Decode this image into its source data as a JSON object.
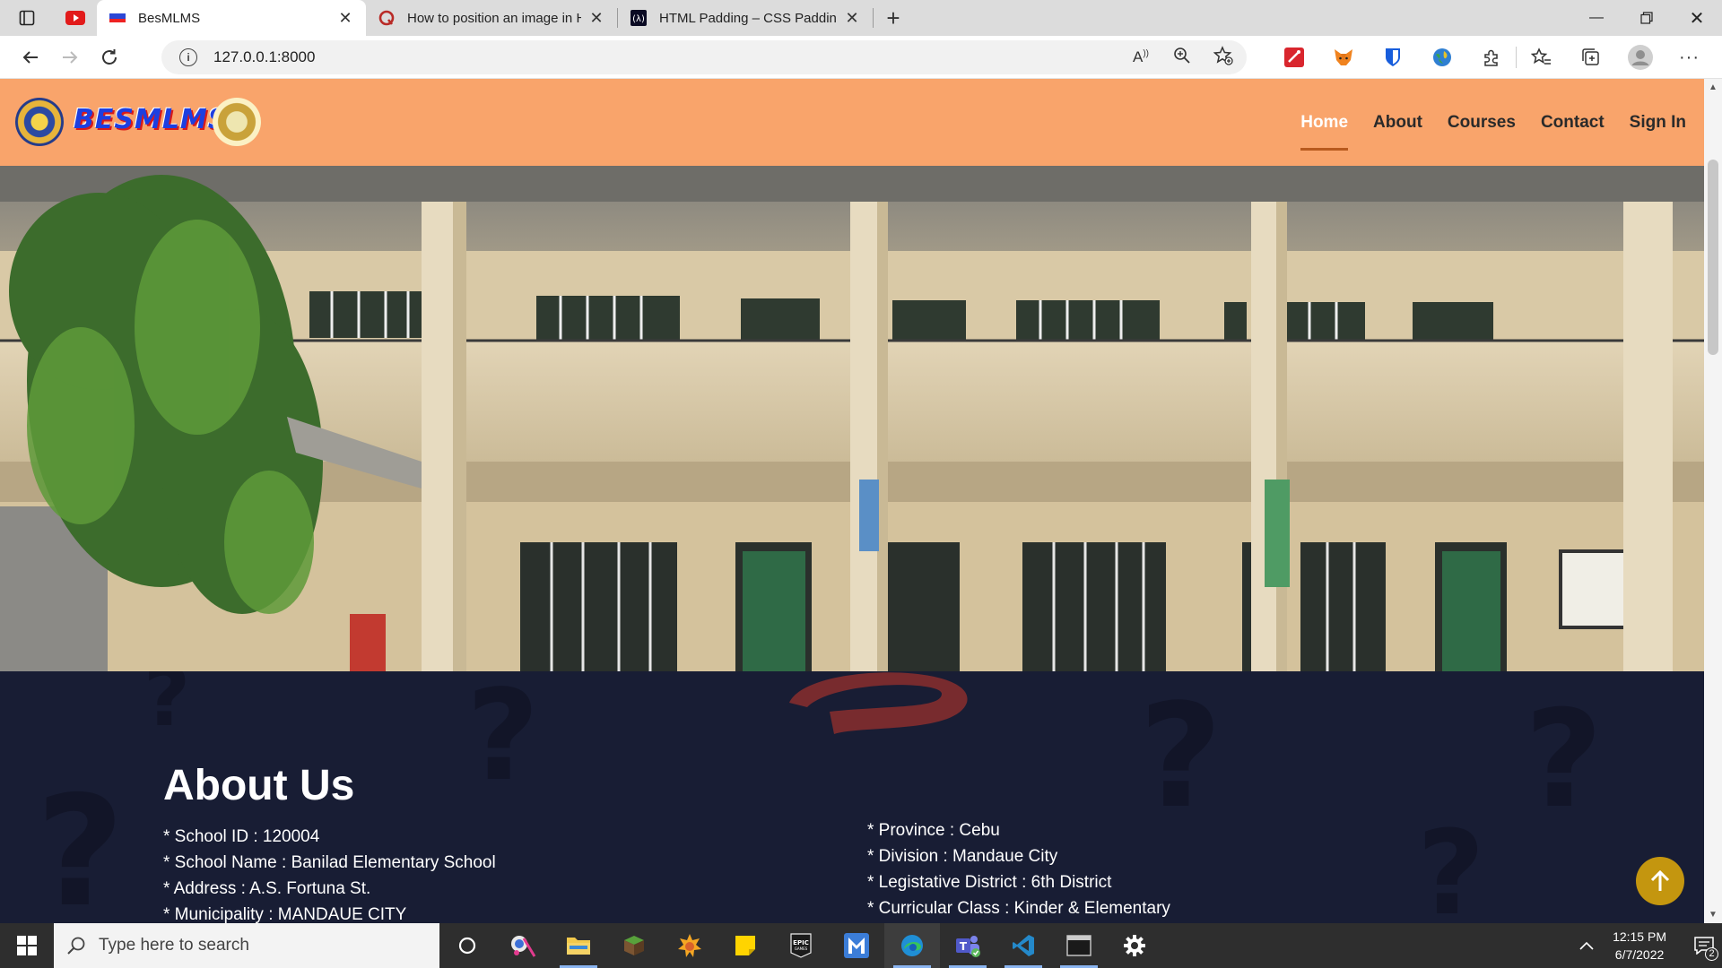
{
  "browser": {
    "tabs": [
      {
        "title": "BesMLMS",
        "active": true
      },
      {
        "title": "How to position an image in HTML",
        "active": false
      },
      {
        "title": "HTML Padding – CSS Padding Or",
        "active": false
      }
    ],
    "url": "127.0.0.1:8000"
  },
  "site": {
    "brand": "BESMLMS",
    "nav": [
      "Home",
      "About",
      "Courses",
      "Contact",
      "Sign In"
    ],
    "active_nav": "Home",
    "colors": {
      "header": "#f9a46b",
      "about_bg": "#181d34",
      "to_top": "#c4960f"
    }
  },
  "about": {
    "heading": "About Us",
    "left": [
      "* School ID : 120004",
      "* School Name : Banilad Elementary School",
      "* Address : A.S. Fortuna St.",
      "* Municipality : MANDAUE CITY"
    ],
    "right": [
      "* Province : Cebu",
      "* Division : Mandaue City",
      "* Legistative District : 6th District",
      "* Curricular Class : Kinder & Elementary"
    ]
  },
  "taskbar": {
    "search_placeholder": "Type here to search",
    "time": "12:15 PM",
    "date": "6/7/2022",
    "notifications": "2"
  }
}
